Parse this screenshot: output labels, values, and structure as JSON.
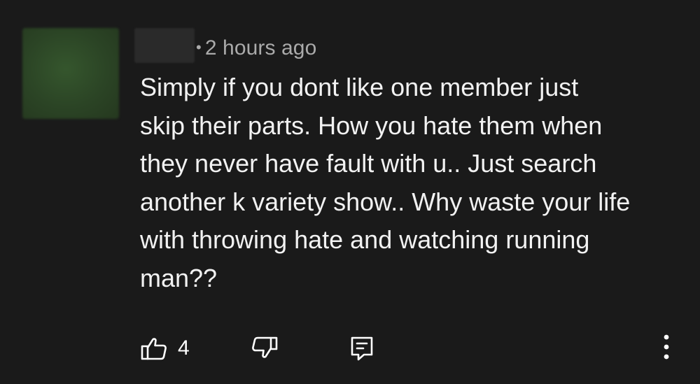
{
  "comment": {
    "timestamp": "2 hours ago",
    "separator": "•",
    "text_lines": [
      "Simply if you dont like one member just",
      "skip their parts. How you hate them when",
      "they never have fault with u.. Just search",
      "another k variety show.. Why waste your life",
      "with throwing hate and watching running",
      "man??"
    ]
  },
  "actions": {
    "like_count": "4",
    "like_icon": "thumbs-up-icon",
    "dislike_icon": "thumbs-down-icon",
    "reply_icon": "reply-comment-icon",
    "more_icon": "vertical-ellipsis-icon"
  },
  "colors": {
    "background": "#1a1a1a",
    "text": "#f2f2f2",
    "meta_text": "#aaaaaa"
  }
}
